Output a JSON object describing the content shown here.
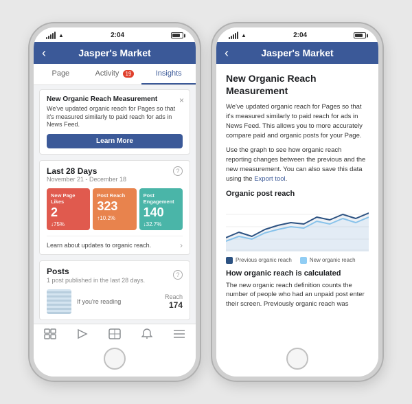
{
  "phones": [
    {
      "id": "phone-left",
      "status": {
        "signal": "●●●●●",
        "wifi": "WiFi",
        "time": "2:04",
        "battery": "full"
      },
      "header": {
        "back_label": "‹",
        "title": "Jasper's Market"
      },
      "tabs": [
        {
          "label": "Page",
          "active": false,
          "badge": null
        },
        {
          "label": "Activity",
          "active": false,
          "badge": "19"
        },
        {
          "label": "Insights",
          "active": true,
          "badge": null
        }
      ],
      "notification": {
        "title": "New Organic Reach Measurement",
        "text": "We've updated organic reach for Pages so that it's measured similarly to paid reach for ads in News Feed.",
        "button_label": "Learn More"
      },
      "stats": {
        "title": "Last 28 Days",
        "subtitle": "November 21 - December 18",
        "cards": [
          {
            "label": "New Page Likes",
            "value": "2",
            "change": "↓75%",
            "color": "red"
          },
          {
            "label": "Post Reach",
            "value": "323",
            "change": "↑10.2%",
            "color": "orange"
          },
          {
            "label": "Post Engagement",
            "value": "140",
            "change": "↓32.7%",
            "color": "teal"
          }
        ],
        "link_text": "Learn about updates to organic reach."
      },
      "posts": {
        "title": "Posts",
        "subtitle": "1 post published in the last 28 days.",
        "items": [
          {
            "preview": "If you're reading",
            "reach_label": "Reach",
            "reach_value": "174"
          }
        ]
      },
      "bottom_nav": [
        {
          "icon": "⊟",
          "label": "pages",
          "active": false
        },
        {
          "icon": "▷",
          "label": "video",
          "active": false
        },
        {
          "icon": "⊞",
          "label": "grid",
          "active": false
        },
        {
          "icon": "🔔",
          "label": "notifications",
          "active": false
        },
        {
          "icon": "≡",
          "label": "menu",
          "active": false
        }
      ]
    },
    {
      "id": "phone-right",
      "status": {
        "signal": "●●●●●",
        "wifi": "WiFi",
        "time": "2:04",
        "battery": "full"
      },
      "header": {
        "back_label": "‹",
        "title": "Jasper's Market"
      },
      "detail": {
        "title": "New Organic Reach Measurement",
        "para1": "We've updated organic reach for Pages so that it's measured similarly to paid reach for ads in News Feed. This allows you to more accurately compare paid and organic posts for your Page.",
        "para2": "Use the graph to see how organic reach reporting changes between the previous and the new measurement. You can also save this data using the ",
        "export_link": "Export tool",
        "para2_end": ".",
        "chart_title": "Organic post reach",
        "chart": {
          "previous_label": "Previous organic reach",
          "new_label": "New organic reach",
          "previous_points": [
            20,
            28,
            22,
            30,
            36,
            40,
            38,
            46,
            42,
            50,
            44,
            52
          ],
          "new_points": [
            15,
            22,
            18,
            25,
            30,
            34,
            32,
            40,
            36,
            44,
            38,
            46
          ]
        },
        "bottom_title": "How organic reach is calculated",
        "bottom_para": "The new organic reach definition counts the number of people who had an unpaid post enter their screen. Previously organic reach was"
      }
    }
  ]
}
